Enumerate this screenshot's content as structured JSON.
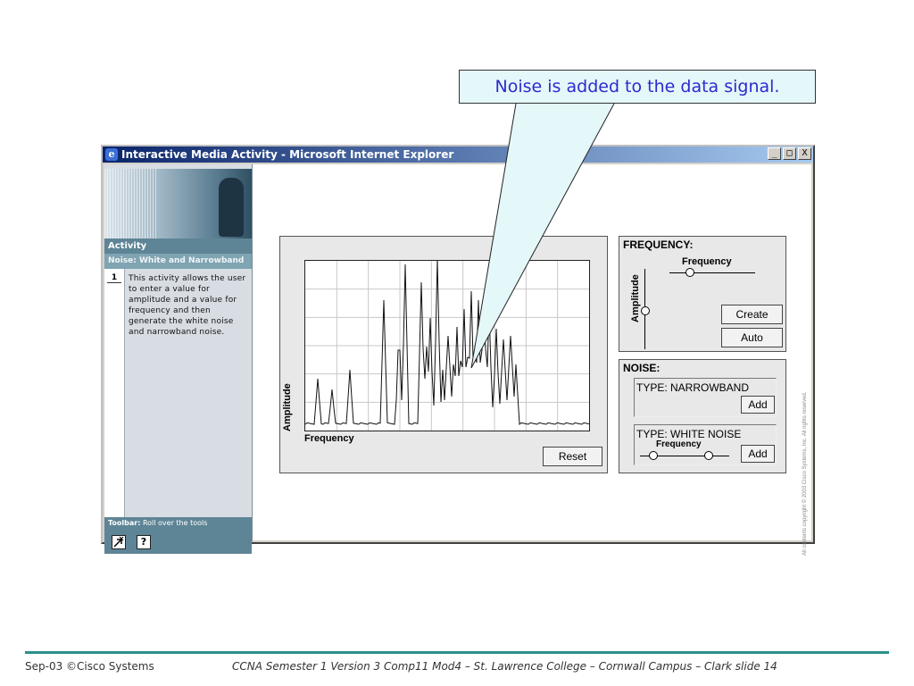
{
  "callout": {
    "text": "Noise is added to the data signal."
  },
  "window": {
    "title": "Interactive Media Activity - Microsoft Internet Explorer",
    "minimize": "_",
    "maximize": "□",
    "close": "X"
  },
  "sidebar": {
    "section": "Activity",
    "subtitle": "Noise: White and Narrowband",
    "step_number": "1",
    "step_text": "This activity allows the user to enter a value for amplitude and a value for frequency and then generate the white noise and narrowband noise.",
    "toolbar_label": "Toolbar:",
    "toolbar_hint": "Roll over the tools",
    "help_glyph": "?"
  },
  "graph": {
    "y_label": "Amplitude",
    "x_label": "Frequency",
    "reset_label": "Reset"
  },
  "frequency_panel": {
    "title": "FREQUENCY:",
    "slider_label": "Frequency",
    "amplitude_label": "Amplitude",
    "create_label": "Create",
    "auto_label": "Auto"
  },
  "noise_panel": {
    "title": "NOISE:",
    "narrowband_type": "TYPE: NARROWBAND",
    "white_type": "TYPE: WHITE  NOISE",
    "white_slider_label": "Frequency",
    "add_label": "Add"
  },
  "copyright": "All contents copyright © 2003 Cisco Systems, Inc. All rights reserved.",
  "footer": {
    "left": "Sep-03 ©Cisco Systems",
    "right": "CCNA Semester 1 Version 3 Comp11 Mod4 – St. Lawrence College – Cornwall Campus – Clark slide 14"
  },
  "colors": {
    "callout_text": "#2b2bcf",
    "callout_bg": "#e4f7f9",
    "titlebar": "#0a246a",
    "sidebar_accent": "#5e8596",
    "footer_rule": "#2a8f8a"
  },
  "icons": [
    "ie-logo-icon",
    "tools-arrow-icon",
    "help-icon"
  ]
}
